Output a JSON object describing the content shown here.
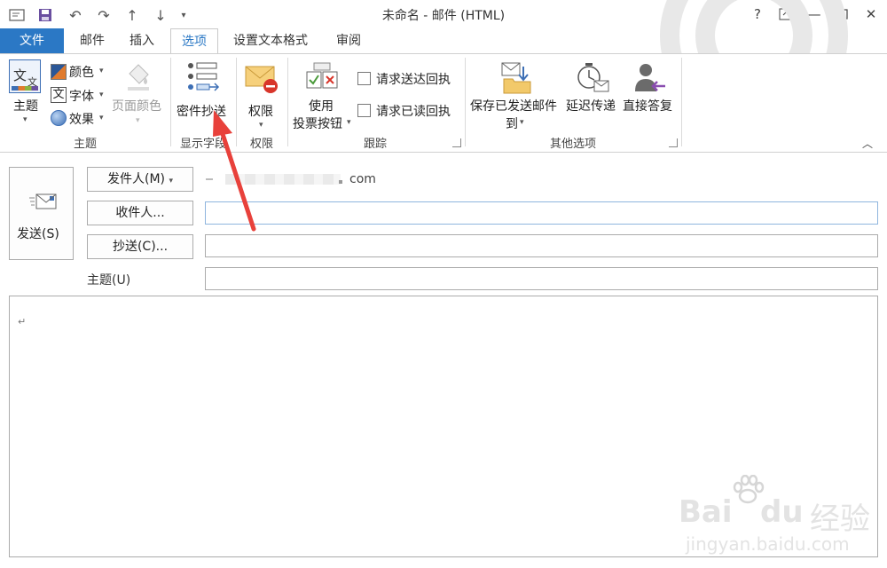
{
  "window": {
    "title": "未命名 - 邮件 (HTML)",
    "help": "?",
    "controls": [
      "restore-ribbon",
      "minimize",
      "maximize",
      "close"
    ]
  },
  "quick_access": [
    "save-icon",
    "undo-icon",
    "redo-icon",
    "up-icon",
    "down-icon",
    "customize-icon"
  ],
  "tabs": [
    {
      "label": "文件",
      "state": "file"
    },
    {
      "label": "邮件",
      "state": ""
    },
    {
      "label": "插入",
      "state": ""
    },
    {
      "label": "选项",
      "state": "active"
    },
    {
      "label": "设置文本格式",
      "state": ""
    },
    {
      "label": "审阅",
      "state": ""
    }
  ],
  "ribbon": {
    "theme_group": {
      "label": "主题",
      "theme": "主题",
      "colors": "颜色",
      "fonts": "字体",
      "effects": "效果",
      "page_color": "页面颜色"
    },
    "fields_group": {
      "label": "显示字段",
      "bcc": "密件抄送"
    },
    "permission_group": {
      "label": "权限",
      "permission": "权限"
    },
    "tracking_group": {
      "label": "跟踪",
      "voting_line1": "使用",
      "voting_line2": "投票按钮",
      "delivery_receipt": "请求送达回执",
      "read_receipt": "请求已读回执"
    },
    "more_group": {
      "label": "其他选项",
      "save_sent_line1": "保存已发送邮件",
      "save_sent_line2": "到",
      "delay": "延迟传递",
      "direct_replies": "直接答复"
    }
  },
  "compose": {
    "send": "发送(S)",
    "from": "发件人(M)",
    "from_value": "com",
    "to": "收件人...",
    "cc": "抄送(C)...",
    "subject": "主题(U)",
    "body_mark": "↵"
  },
  "colors": {
    "accent": "#2b78c5",
    "annotation": "#e8413b"
  },
  "watermark": {
    "brand": "Bai",
    "brand2": "du",
    "brand_cn": "经验",
    "url": "jingyan.baidu.com"
  }
}
